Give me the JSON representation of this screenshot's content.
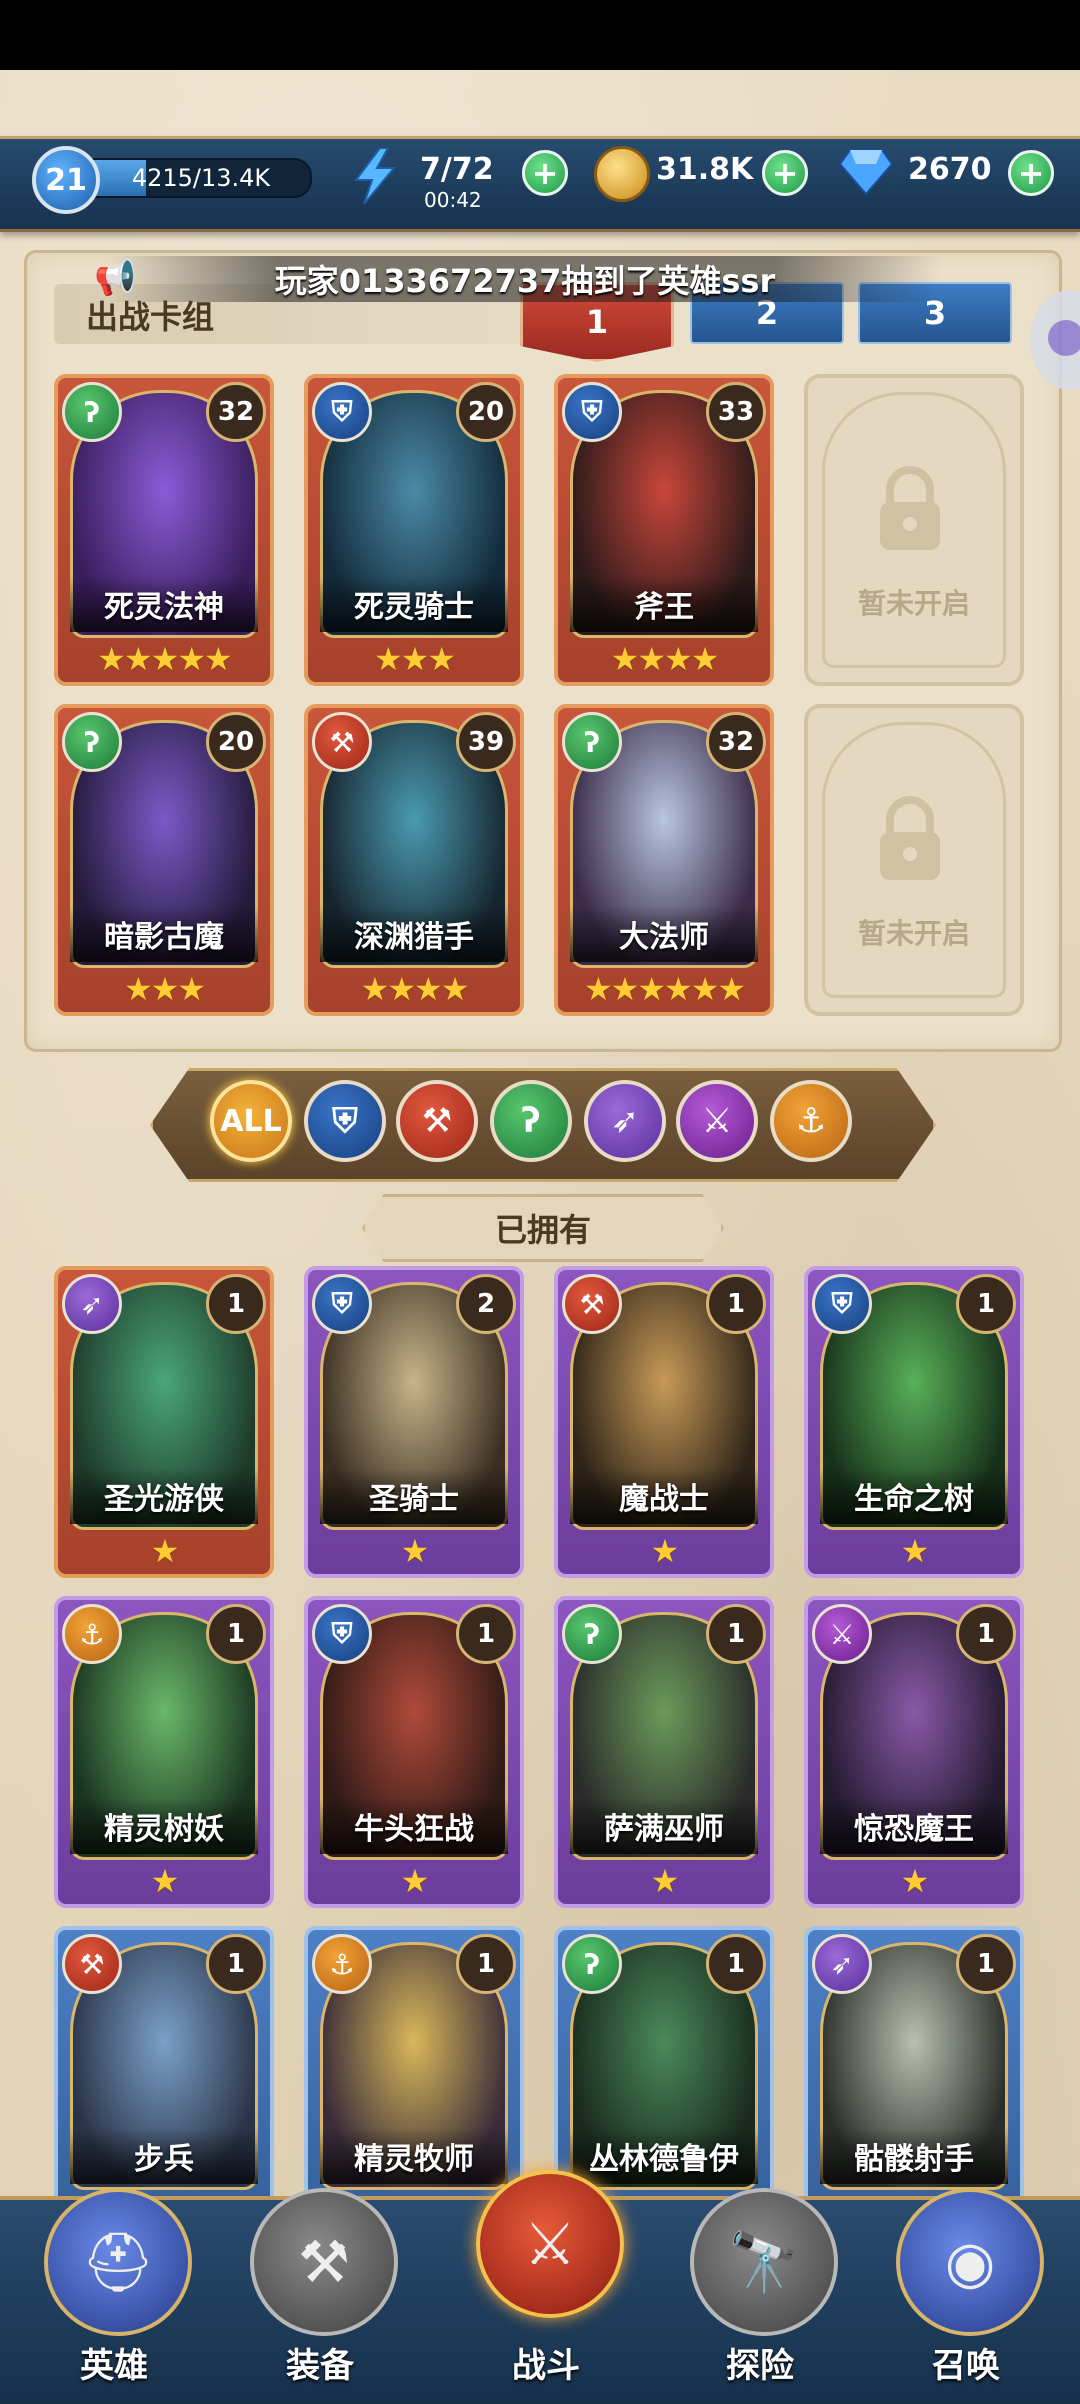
{
  "resources": {
    "player_level": "21",
    "xp_text": "4215/13.4K",
    "xp_progress": 0.31,
    "energy_text": "7/72",
    "energy_timer": "00:42",
    "gold_text": "31.8K",
    "gems_text": "2670"
  },
  "announcement": "玩家0133672737抽到了英雄ssr",
  "deck": {
    "title": "出战卡组",
    "tabs": [
      "1",
      "2",
      "3"
    ],
    "active_tab": "1",
    "locked_label": "暂未开启",
    "cards": [
      {
        "name": "死灵法神",
        "level": "32",
        "stars": "★★★★★",
        "cls": "green",
        "icon": "healer-icon",
        "frame": "orange",
        "palette": [
          "#8b5bd6",
          "#3a1d5c"
        ]
      },
      {
        "name": "死灵骑士",
        "level": "20",
        "stars": "★★★",
        "cls": "blue",
        "icon": "shield-icon",
        "frame": "orange",
        "palette": [
          "#4b8aa6",
          "#122a3a"
        ]
      },
      {
        "name": "斧王",
        "level": "33",
        "stars": "★★★★",
        "cls": "blue",
        "icon": "shield-icon",
        "frame": "orange",
        "palette": [
          "#c8463a",
          "#2a1a1a"
        ]
      },
      {
        "name": "暗影古魔",
        "level": "20",
        "stars": "★★★",
        "cls": "green",
        "icon": "healer-icon",
        "frame": "orange",
        "palette": [
          "#7a5ac8",
          "#241a3a"
        ]
      },
      {
        "name": "深渊猎手",
        "level": "39",
        "stars": "★★★★",
        "cls": "red",
        "icon": "axe-icon",
        "frame": "orange",
        "palette": [
          "#4a9ab0",
          "#16242e"
        ]
      },
      {
        "name": "大法师",
        "level": "32",
        "stars": "★★★★★★",
        "cls": "green",
        "icon": "healer-icon",
        "frame": "orange",
        "palette": [
          "#b8c6e0",
          "#3a2a48"
        ]
      }
    ]
  },
  "filters": [
    {
      "label": "ALL",
      "icon": "all-icon",
      "cls": "all"
    },
    {
      "label": "",
      "icon": "shield-icon",
      "cls": "blue"
    },
    {
      "label": "",
      "icon": "axe-icon",
      "cls": "red"
    },
    {
      "label": "",
      "icon": "healer-icon",
      "cls": "green"
    },
    {
      "label": "",
      "icon": "bow-icon",
      "cls": "purple"
    },
    {
      "label": "",
      "icon": "crossed-swords-icon",
      "cls": "magenta"
    },
    {
      "label": "",
      "icon": "anchor-icon",
      "cls": "orange"
    }
  ],
  "owned": {
    "title": "已拥有",
    "cards": [
      {
        "name": "圣光游侠",
        "level": "1",
        "stars": "★",
        "cls": "purple",
        "icon": "bow-icon",
        "frame": "orange",
        "palette": [
          "#4aa67a",
          "#1e3a2a"
        ]
      },
      {
        "name": "圣骑士",
        "level": "2",
        "stars": "★",
        "cls": "blue",
        "icon": "shield-icon",
        "frame": "purple",
        "palette": [
          "#c8b48a",
          "#3a2e22"
        ]
      },
      {
        "name": "魔战士",
        "level": "1",
        "stars": "★",
        "cls": "red",
        "icon": "axe-icon",
        "frame": "purple",
        "palette": [
          "#c89a58",
          "#2e2418"
        ]
      },
      {
        "name": "生命之树",
        "level": "1",
        "stars": "★",
        "cls": "blue",
        "icon": "shield-icon",
        "frame": "purple",
        "palette": [
          "#58b058",
          "#17301a"
        ]
      },
      {
        "name": "精灵树妖",
        "level": "1",
        "stars": "★",
        "cls": "orange",
        "icon": "anchor-icon",
        "frame": "purple",
        "palette": [
          "#6ab86a",
          "#1a3420"
        ]
      },
      {
        "name": "牛头狂战",
        "level": "1",
        "stars": "★",
        "cls": "blue",
        "icon": "shield-icon",
        "frame": "purple",
        "palette": [
          "#b04a3a",
          "#2e1a16"
        ]
      },
      {
        "name": "萨满巫师",
        "level": "1",
        "stars": "★",
        "cls": "green",
        "icon": "healer-icon",
        "frame": "purple",
        "palette": [
          "#6a9a5a",
          "#2a2a2a"
        ]
      },
      {
        "name": "惊恐魔王",
        "level": "1",
        "stars": "★",
        "cls": "magenta",
        "icon": "crossed-swords-icon",
        "frame": "purple",
        "palette": [
          "#8a58a8",
          "#221a2e"
        ]
      },
      {
        "name": "步兵",
        "level": "1",
        "stars": "",
        "cls": "red",
        "icon": "axe-icon",
        "frame": "blue",
        "palette": [
          "#7aa0c8",
          "#2a3448"
        ]
      },
      {
        "name": "精灵牧师",
        "level": "1",
        "stars": "★",
        "cls": "orange",
        "icon": "anchor-icon",
        "frame": "blue",
        "palette": [
          "#d8b85a",
          "#3a2c3a"
        ]
      },
      {
        "name": "丛林德鲁伊",
        "level": "1",
        "stars": "★",
        "cls": "green",
        "icon": "healer-icon",
        "frame": "blue",
        "palette": [
          "#4a8a5a",
          "#1a2a1e"
        ]
      },
      {
        "name": "骷髅射手",
        "level": "1",
        "stars": "",
        "cls": "purple",
        "icon": "bow-icon",
        "frame": "blue",
        "palette": [
          "#b8c0b0",
          "#2a2e2a"
        ]
      }
    ]
  },
  "icons": {
    "healer-icon": "ʔ",
    "shield-icon": "⛨",
    "axe-icon": "⚒",
    "bow-icon": "➶",
    "crossed-swords-icon": "⚔",
    "anchor-icon": "⚓",
    "all-icon": "ALL"
  },
  "nav": [
    {
      "label": "英雄",
      "icon": "helmet-icon",
      "glyph": "⛑"
    },
    {
      "label": "装备",
      "icon": "hammer-icon",
      "glyph": "⚒"
    },
    {
      "label": "战斗",
      "icon": "battle-icon",
      "glyph": "⚔"
    },
    {
      "label": "探险",
      "icon": "telescope-icon",
      "glyph": "🔭"
    },
    {
      "label": "召唤",
      "icon": "portal-icon",
      "glyph": "◉"
    }
  ],
  "active_nav": "战斗",
  "colors": {
    "bar_bg": "#1f4163",
    "gold_accent": "#c3a06a",
    "plus_green": "#1f9a4a"
  }
}
